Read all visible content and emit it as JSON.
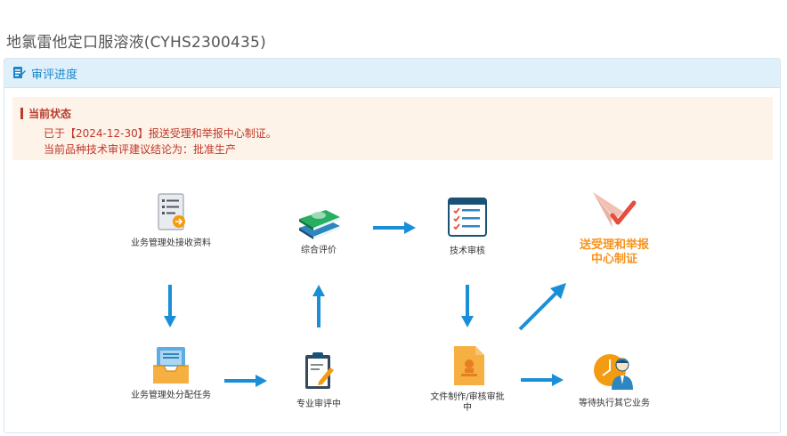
{
  "drug": {
    "title": "地氯雷他定口服溶液(CYHS2300435)"
  },
  "panel": {
    "icon": "review-progress-icon",
    "title": "审评进度"
  },
  "status": {
    "heading": "当前状态",
    "line1": "已于【2024-12-30】报送受理和举报中心制证。",
    "line2": "当前品种技术审评建议结论为：批准生产"
  },
  "flow": {
    "receive": {
      "label": "业务管理处接收资料",
      "icon": "document-receive-icon"
    },
    "assign": {
      "label": "业务管理处分配任务",
      "icon": "inbox-assign-icon"
    },
    "review": {
      "label": "专业审评中",
      "icon": "clipboard-review-icon"
    },
    "comprehensive": {
      "label": "综合评价",
      "icon": "books-evaluate-icon"
    },
    "tech_audit": {
      "label": "技术审核",
      "icon": "checklist-icon"
    },
    "docs": {
      "label": "文件制作/审核审批中",
      "icon": "document-stamp-icon"
    },
    "certify": {
      "label": "送受理和举报中心制证",
      "icon": "paper-plane-icon",
      "current": true
    },
    "other": {
      "label": "等待执行其它业务",
      "icon": "user-clock-icon"
    }
  },
  "colors": {
    "arrow": "#1a8fd8",
    "highlight": "#f7931e",
    "status_text": "#c0392b"
  }
}
